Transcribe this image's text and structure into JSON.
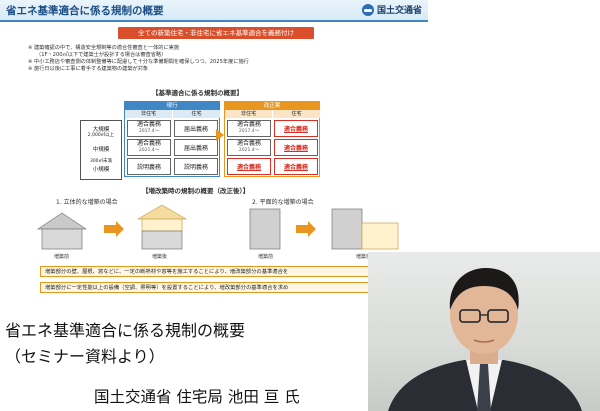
{
  "slide": {
    "title": "省エネ基準適合に係る規制の概要",
    "ministry": "国土交通省",
    "banner": "全ての新築住宅・非住宅に省エネ基準適合を義務付け",
    "notes": [
      "※ 建築確認の中で、構造安全規制等の適合性審査と一体的に実施",
      "（1F・200㎡以下で建築士が設計する場合は審査省略）",
      "※ 中小工務店や審査側の体制整備等に配慮して十分な準備期間を確保しつつ、2025年度に施行",
      "※ 施行日以後に工事に着手する建築物の建築が対象"
    ],
    "table_title": "【基準適合に係る規制の概要】",
    "sizes": {
      "large": "大規模",
      "large_sub": "2,000㎡以上",
      "medium": "中規模",
      "small_sub": "300㎡未満",
      "small": "小規模"
    },
    "before": {
      "header": "現行",
      "col_non_res": "非住宅",
      "col_res": "住宅",
      "rows": [
        {
          "non_res": "適合義務",
          "non_res_sub": "2017.4～",
          "res": "届出義務"
        },
        {
          "non_res": "適合義務",
          "non_res_sub": "2021.4～",
          "res": "届出義務"
        },
        {
          "non_res": "説明義務",
          "non_res_sub": "",
          "res": "説明義務"
        }
      ]
    },
    "after": {
      "header": "改正案",
      "col_non_res": "非住宅",
      "col_res": "住宅",
      "rows": [
        {
          "non_res": "適合義務",
          "non_res_sub": "2017.4～",
          "res": "適合義務"
        },
        {
          "non_res": "適合義務",
          "non_res_sub": "2021.4～",
          "res": "適合義務"
        },
        {
          "non_res": "適合義務",
          "non_res_sub": "",
          "res": "適合義務"
        }
      ]
    },
    "extension_title": "【増改築時の規制の概要（改正後）】",
    "ext_case1": "1. 立体的な増築の場合",
    "ext_case2": "2. 平面的な増築の場合",
    "fig_before_1": "増築前",
    "fig_after_1": "増築後",
    "fig_before_2": "増築前",
    "fig_after_2": "増築後",
    "result_1": "増築部分の壁、屋根、窓などに、一定の断熱材や窓等を施工することにより、増改築部分の基準適合を",
    "result_2": "増築部分に一定性能以上の設備（空調、照明等）を設置することにより、増改築部分の基準適合を求め"
  },
  "caption": {
    "title": "省エネ基準適合に係る規制の概要",
    "source": "（セミナー資料より）",
    "speaker": "国土交通省 住宅局 池田 亘 氏"
  },
  "colors": {
    "slide_accent": "#3f88c5",
    "banner_red": "#d94f2b",
    "revision_orange": "#e8961f",
    "highlight_red": "#d93025"
  }
}
